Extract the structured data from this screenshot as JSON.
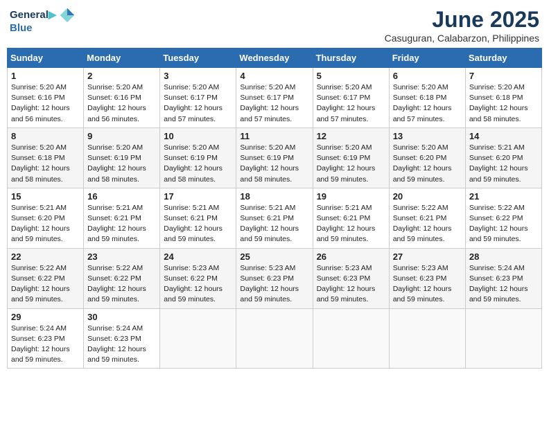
{
  "logo": {
    "line1": "General",
    "line2": "Blue"
  },
  "title": "June 2025",
  "subtitle": "Casuguran, Calabarzon, Philippines",
  "headers": [
    "Sunday",
    "Monday",
    "Tuesday",
    "Wednesday",
    "Thursday",
    "Friday",
    "Saturday"
  ],
  "weeks": [
    [
      {
        "day": "1",
        "sunrise": "5:20 AM",
        "sunset": "6:16 PM",
        "daylight": "12 hours and 56 minutes."
      },
      {
        "day": "2",
        "sunrise": "5:20 AM",
        "sunset": "6:16 PM",
        "daylight": "12 hours and 56 minutes."
      },
      {
        "day": "3",
        "sunrise": "5:20 AM",
        "sunset": "6:17 PM",
        "daylight": "12 hours and 57 minutes."
      },
      {
        "day": "4",
        "sunrise": "5:20 AM",
        "sunset": "6:17 PM",
        "daylight": "12 hours and 57 minutes."
      },
      {
        "day": "5",
        "sunrise": "5:20 AM",
        "sunset": "6:17 PM",
        "daylight": "12 hours and 57 minutes."
      },
      {
        "day": "6",
        "sunrise": "5:20 AM",
        "sunset": "6:18 PM",
        "daylight": "12 hours and 57 minutes."
      },
      {
        "day": "7",
        "sunrise": "5:20 AM",
        "sunset": "6:18 PM",
        "daylight": "12 hours and 58 minutes."
      }
    ],
    [
      {
        "day": "8",
        "sunrise": "5:20 AM",
        "sunset": "6:18 PM",
        "daylight": "12 hours and 58 minutes."
      },
      {
        "day": "9",
        "sunrise": "5:20 AM",
        "sunset": "6:19 PM",
        "daylight": "12 hours and 58 minutes."
      },
      {
        "day": "10",
        "sunrise": "5:20 AM",
        "sunset": "6:19 PM",
        "daylight": "12 hours and 58 minutes."
      },
      {
        "day": "11",
        "sunrise": "5:20 AM",
        "sunset": "6:19 PM",
        "daylight": "12 hours and 58 minutes."
      },
      {
        "day": "12",
        "sunrise": "5:20 AM",
        "sunset": "6:19 PM",
        "daylight": "12 hours and 59 minutes."
      },
      {
        "day": "13",
        "sunrise": "5:20 AM",
        "sunset": "6:20 PM",
        "daylight": "12 hours and 59 minutes."
      },
      {
        "day": "14",
        "sunrise": "5:21 AM",
        "sunset": "6:20 PM",
        "daylight": "12 hours and 59 minutes."
      }
    ],
    [
      {
        "day": "15",
        "sunrise": "5:21 AM",
        "sunset": "6:20 PM",
        "daylight": "12 hours and 59 minutes."
      },
      {
        "day": "16",
        "sunrise": "5:21 AM",
        "sunset": "6:21 PM",
        "daylight": "12 hours and 59 minutes."
      },
      {
        "day": "17",
        "sunrise": "5:21 AM",
        "sunset": "6:21 PM",
        "daylight": "12 hours and 59 minutes."
      },
      {
        "day": "18",
        "sunrise": "5:21 AM",
        "sunset": "6:21 PM",
        "daylight": "12 hours and 59 minutes."
      },
      {
        "day": "19",
        "sunrise": "5:21 AM",
        "sunset": "6:21 PM",
        "daylight": "12 hours and 59 minutes."
      },
      {
        "day": "20",
        "sunrise": "5:22 AM",
        "sunset": "6:21 PM",
        "daylight": "12 hours and 59 minutes."
      },
      {
        "day": "21",
        "sunrise": "5:22 AM",
        "sunset": "6:22 PM",
        "daylight": "12 hours and 59 minutes."
      }
    ],
    [
      {
        "day": "22",
        "sunrise": "5:22 AM",
        "sunset": "6:22 PM",
        "daylight": "12 hours and 59 minutes."
      },
      {
        "day": "23",
        "sunrise": "5:22 AM",
        "sunset": "6:22 PM",
        "daylight": "12 hours and 59 minutes."
      },
      {
        "day": "24",
        "sunrise": "5:23 AM",
        "sunset": "6:22 PM",
        "daylight": "12 hours and 59 minutes."
      },
      {
        "day": "25",
        "sunrise": "5:23 AM",
        "sunset": "6:23 PM",
        "daylight": "12 hours and 59 minutes."
      },
      {
        "day": "26",
        "sunrise": "5:23 AM",
        "sunset": "6:23 PM",
        "daylight": "12 hours and 59 minutes."
      },
      {
        "day": "27",
        "sunrise": "5:23 AM",
        "sunset": "6:23 PM",
        "daylight": "12 hours and 59 minutes."
      },
      {
        "day": "28",
        "sunrise": "5:24 AM",
        "sunset": "6:23 PM",
        "daylight": "12 hours and 59 minutes."
      }
    ],
    [
      {
        "day": "29",
        "sunrise": "5:24 AM",
        "sunset": "6:23 PM",
        "daylight": "12 hours and 59 minutes."
      },
      {
        "day": "30",
        "sunrise": "5:24 AM",
        "sunset": "6:23 PM",
        "daylight": "12 hours and 59 minutes."
      },
      null,
      null,
      null,
      null,
      null
    ]
  ]
}
